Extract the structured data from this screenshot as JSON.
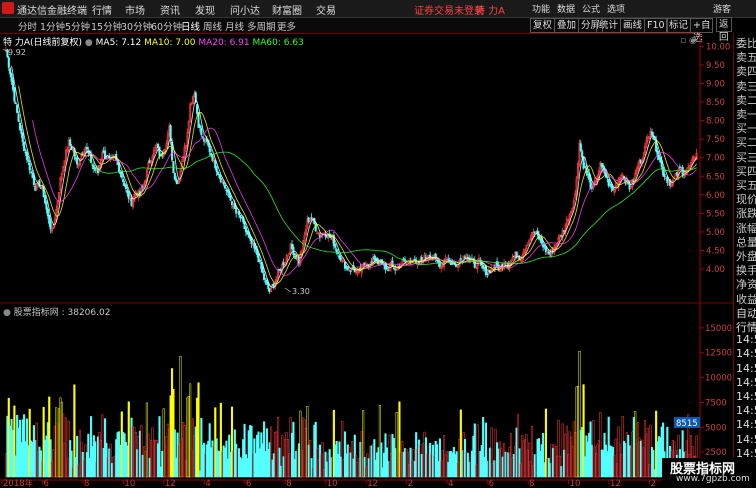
{
  "app": {
    "title": "通达信金融终端"
  },
  "menu": [
    "行情",
    "市场",
    "资讯",
    "发现",
    "问小达",
    "财富圈",
    "交易"
  ],
  "topbar": {
    "warning": "证券交易未登录",
    "stock_name": "特 力A",
    "items": [
      "功能",
      "数据",
      "公式",
      "选项",
      "游客"
    ]
  },
  "toolbar": {
    "periods": [
      "分时",
      "1分钟",
      "5分钟",
      "15分钟",
      "30分钟",
      "60分钟",
      "日线",
      "周线",
      "月线",
      "多周期",
      "更多"
    ],
    "active": "日线",
    "right_buttons": [
      "复权",
      "叠加",
      "分屏",
      "统计",
      "画线",
      "F10",
      "标记",
      "+自选",
      "返回"
    ]
  },
  "legend": {
    "title": "特 力A(日线前复权)",
    "ma5": "MA5: 7.12",
    "ma10": "MA10: 7.00",
    "ma20": "MA20: 6.91",
    "ma60": "MA60: 6.63"
  },
  "annotations": {
    "high": "9.92",
    "low": "3.30"
  },
  "price_axis": [
    "10.00",
    "9.50",
    "9.00",
    "8.50",
    "8.00",
    "7.50",
    "7.00",
    "6.50",
    "6.00",
    "5.50",
    "5.00",
    "4.50",
    "4.00"
  ],
  "volume": {
    "legend": "股票指标网 : 38206.02",
    "axis": [
      "15000",
      "12500",
      "10000",
      "7500",
      "5000",
      "2500"
    ],
    "marker": "8515"
  },
  "date_axis": [
    "2018年",
    "6",
    "8",
    "10",
    "12",
    "4",
    "6",
    "8",
    "10",
    "12",
    "2",
    "4",
    "6",
    "8",
    "10",
    "12",
    "2",
    "4"
  ],
  "rightpanel": [
    "委比",
    "卖五",
    "卖四",
    "卖三",
    "卖二",
    "卖一",
    "买一",
    "买二",
    "买三",
    "买四",
    "买五",
    "现价",
    "涨跌",
    "涨幅",
    "总量",
    "外盘",
    "换手",
    "净资",
    "收益",
    "自动",
    "行情",
    "14:5",
    "14:5",
    "14:5",
    "14:5",
    "14:5",
    "14:5",
    "14:5",
    "14:5",
    "14:5",
    "14:5",
    "14:5"
  ],
  "watermark": {
    "title": "股票指标网",
    "url": "www.7gpzb.com"
  },
  "colors": {
    "up": "#ff3c3c",
    "down": "#54ffff",
    "ma5": "#ffffff",
    "ma10": "#ffff00",
    "ma20": "#ff40ff",
    "ma60": "#30ff30",
    "vol_highlight": "#ffff00"
  },
  "chart_data": {
    "type": "candlestick",
    "price_ylim": [
      3.3,
      10.2
    ],
    "volume_ylim": [
      0,
      17000
    ],
    "close_series": [
      9.92,
      9.3,
      8.6,
      8.0,
      7.4,
      7.0,
      6.6,
      6.2,
      6.3,
      6.0,
      5.4,
      5.0,
      5.6,
      6.4,
      7.0,
      7.4,
      7.2,
      6.8,
      7.1,
      7.3,
      7.0,
      6.7,
      6.6,
      7.2,
      7.0,
      6.9,
      7.0,
      6.7,
      6.4,
      6.0,
      5.8,
      6.1,
      6.0,
      6.3,
      6.8,
      7.1,
      7.3,
      7.0,
      7.3,
      7.8,
      6.6,
      6.3,
      6.9,
      7.4,
      8.4,
      8.8,
      7.9,
      7.5,
      7.4,
      7.1,
      6.8,
      6.5,
      6.3,
      6.0,
      5.8,
      5.5,
      5.4,
      5.1,
      4.8,
      4.6,
      4.4,
      4.0,
      3.6,
      3.4,
      3.6,
      3.9,
      4.1,
      4.3,
      4.6,
      4.4,
      4.2,
      4.7,
      5.3,
      5.4,
      5.1,
      4.9,
      5.0,
      4.9,
      4.8,
      4.5,
      4.3,
      4.1,
      4.0,
      4.0,
      3.9,
      4.0,
      4.2,
      4.1,
      4.3,
      4.2,
      4.1,
      4.0,
      4.1,
      4.0,
      4.1,
      4.2,
      4.2,
      4.3,
      4.1,
      4.2,
      4.3,
      4.4,
      4.3,
      4.2,
      4.1,
      4.3,
      4.2,
      4.1,
      4.2,
      4.3,
      4.4,
      4.2,
      4.1,
      4.2,
      4.0,
      3.9,
      4.0,
      4.1,
      4.0,
      4.2,
      4.1,
      4.3,
      4.4,
      4.3,
      4.6,
      4.8,
      5.0,
      4.9,
      4.7,
      4.5,
      4.4,
      4.6,
      4.8,
      5.0,
      5.3,
      5.6,
      6.0,
      7.4,
      6.8,
      6.5,
      6.1,
      6.4,
      6.8,
      6.6,
      6.3,
      6.1,
      6.3,
      6.6,
      6.4,
      6.2,
      6.4,
      6.8,
      7.0,
      7.4,
      7.8,
      7.4,
      7.0,
      6.6,
      6.4,
      6.3,
      6.5,
      6.7,
      6.6,
      6.7,
      6.9,
      7.12
    ]
  }
}
